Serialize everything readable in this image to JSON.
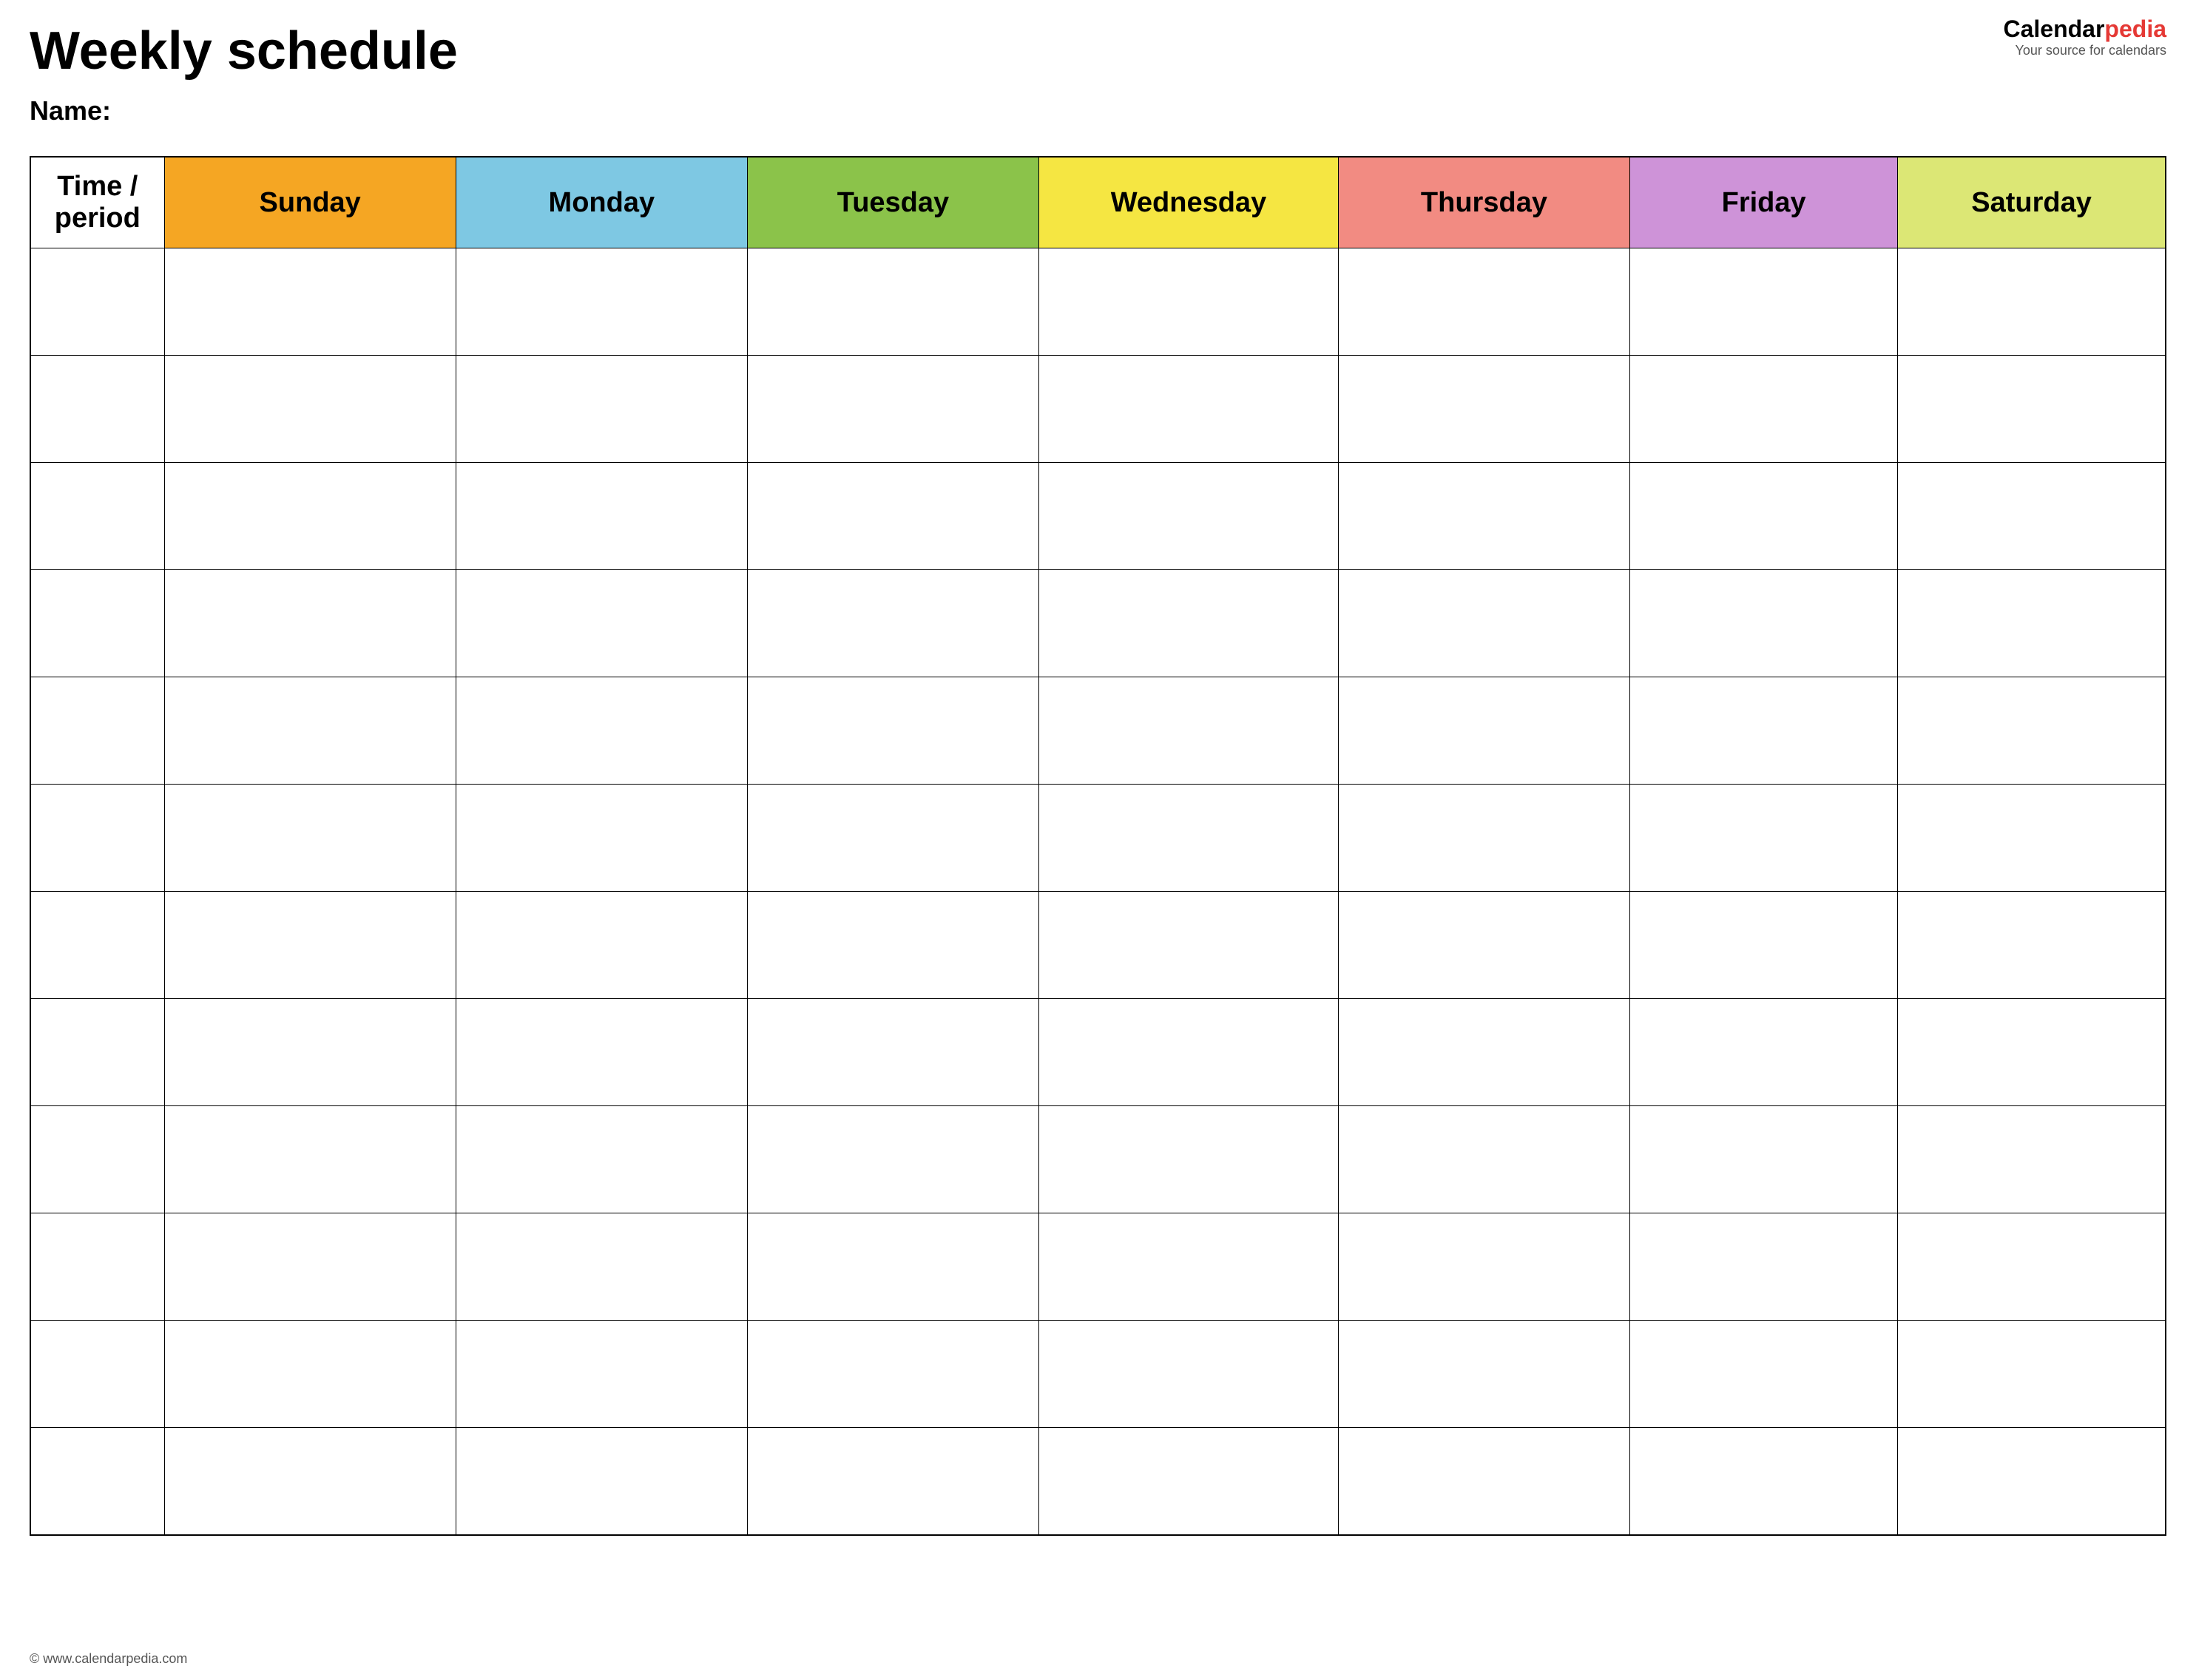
{
  "page": {
    "title": "Weekly schedule",
    "name_label": "Name:",
    "logo_calendar": "Calendar",
    "logo_pedia": "pedia",
    "logo_tagline": "Your source for calendars",
    "footer_url": "© www.calendarpedia.com"
  },
  "table": {
    "headers": [
      {
        "key": "time",
        "label": "Time / period",
        "color_class": "col-time"
      },
      {
        "key": "sunday",
        "label": "Sunday",
        "color_class": "col-sunday"
      },
      {
        "key": "monday",
        "label": "Monday",
        "color_class": "col-monday"
      },
      {
        "key": "tuesday",
        "label": "Tuesday",
        "color_class": "col-tuesday"
      },
      {
        "key": "wednesday",
        "label": "Wednesday",
        "color_class": "col-wednesday"
      },
      {
        "key": "thursday",
        "label": "Thursday",
        "color_class": "col-thursday"
      },
      {
        "key": "friday",
        "label": "Friday",
        "color_class": "col-friday"
      },
      {
        "key": "saturday",
        "label": "Saturday",
        "color_class": "col-saturday"
      }
    ],
    "row_count": 12
  }
}
